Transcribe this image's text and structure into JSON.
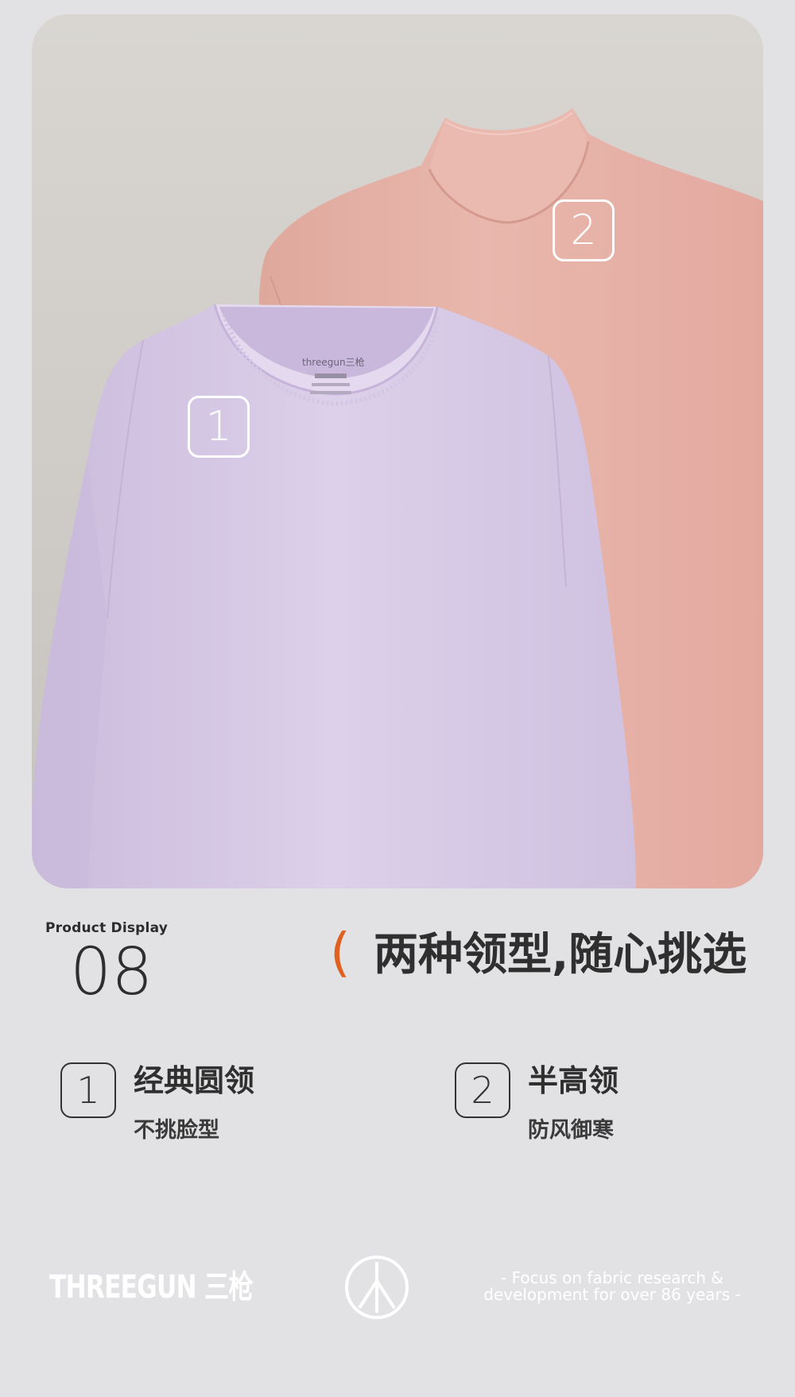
{
  "hero": {
    "markers": [
      "1",
      "2"
    ],
    "shirt_label_brand": "threegun三枪"
  },
  "product_display": {
    "label": "Product Display",
    "number": "08"
  },
  "headline": {
    "paren": "(",
    "text": "两种领型,随心挑选"
  },
  "features": [
    {
      "number": "1",
      "title": "经典圆领",
      "subtitle": "不挑脸型"
    },
    {
      "number": "2",
      "title": "半高领",
      "subtitle": "防风御寒"
    }
  ],
  "footer": {
    "brand": "THREEGUN 三枪",
    "logo_icon": "threegun-logo-icon",
    "tagline_line1": "- Focus on fabric research &",
    "tagline_line2": "development for over 86 years -"
  },
  "colors": {
    "background": "#e2e1e4",
    "accent": "#e0601f",
    "lilac_shirt": "#d7c9e6",
    "pink_shirt": "#e6b2a8"
  }
}
